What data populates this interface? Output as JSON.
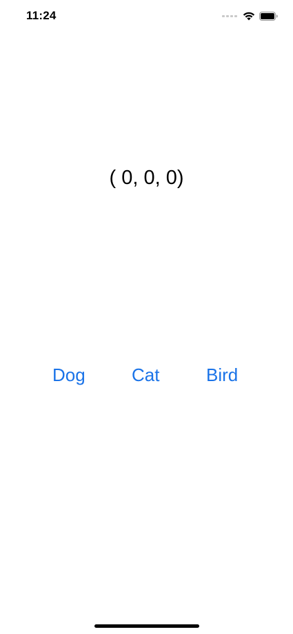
{
  "status_bar": {
    "time": "11:24",
    "icons": [
      "signal-icon",
      "wifi-icon",
      "battery-icon"
    ]
  },
  "score": {
    "text": "( 0, 0, 0)"
  },
  "buttons": [
    {
      "label": "Dog"
    },
    {
      "label": "Cat"
    },
    {
      "label": "Bird"
    }
  ],
  "colors": {
    "accent": "#1a73e8",
    "text": "#000000",
    "background": "#ffffff"
  }
}
